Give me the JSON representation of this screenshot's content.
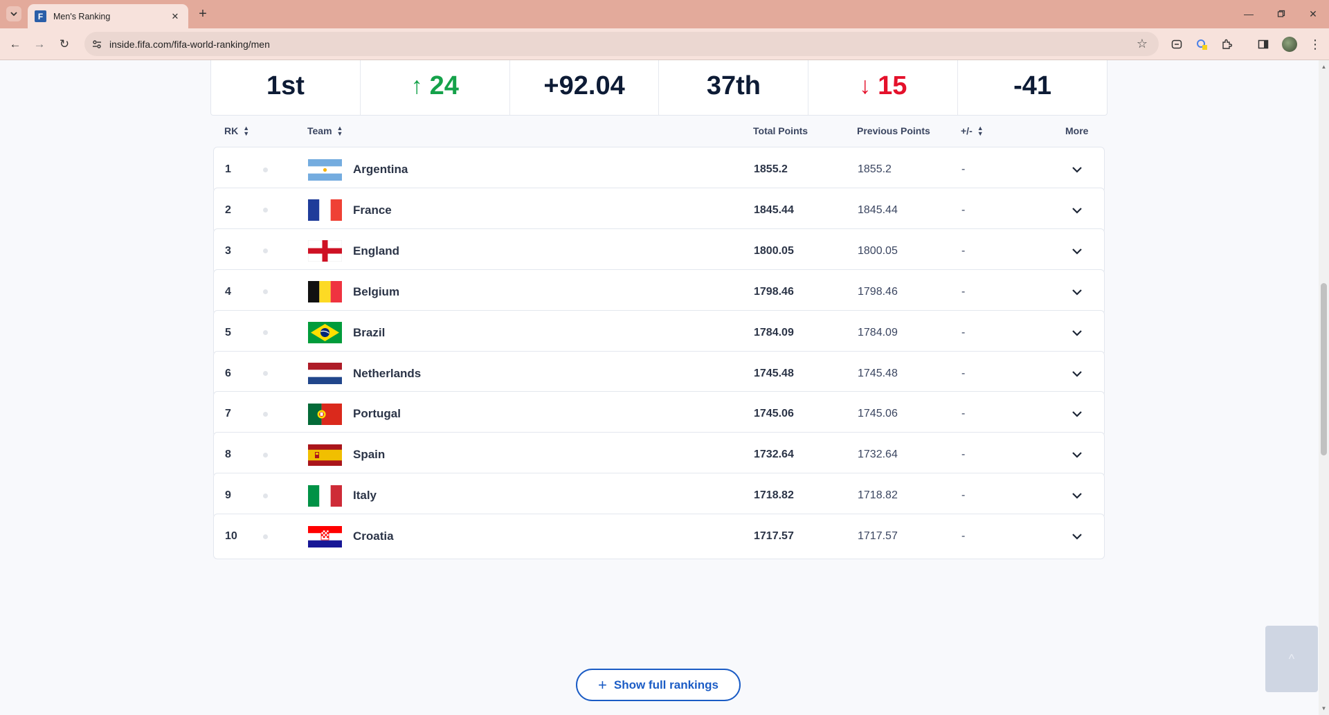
{
  "browser": {
    "tab_title": "Men's Ranking",
    "favicon_letter": "F",
    "url": "inside.fifa.com/fifa-world-ranking/men"
  },
  "stats": [
    {
      "value": "1st",
      "trend": "none"
    },
    {
      "value": "24",
      "trend": "up",
      "color": "#15a24a"
    },
    {
      "value": "+92.04",
      "trend": "none"
    },
    {
      "value": "37th",
      "trend": "none"
    },
    {
      "value": "15",
      "trend": "down",
      "color": "#e4112b"
    },
    {
      "value": "-41",
      "trend": "none"
    }
  ],
  "table": {
    "headers": {
      "rank": "RK",
      "team": "Team",
      "total": "Total Points",
      "previous": "Previous Points",
      "diff": "+/-",
      "more": "More"
    },
    "rows": [
      {
        "rank": "1",
        "team": "Argentina",
        "total": "1855.2",
        "previous": "1855.2",
        "diff": "-",
        "flag": "argentina"
      },
      {
        "rank": "2",
        "team": "France",
        "total": "1845.44",
        "previous": "1845.44",
        "diff": "-",
        "flag": "france"
      },
      {
        "rank": "3",
        "team": "England",
        "total": "1800.05",
        "previous": "1800.05",
        "diff": "-",
        "flag": "england"
      },
      {
        "rank": "4",
        "team": "Belgium",
        "total": "1798.46",
        "previous": "1798.46",
        "diff": "-",
        "flag": "belgium"
      },
      {
        "rank": "5",
        "team": "Brazil",
        "total": "1784.09",
        "previous": "1784.09",
        "diff": "-",
        "flag": "brazil"
      },
      {
        "rank": "6",
        "team": "Netherlands",
        "total": "1745.48",
        "previous": "1745.48",
        "diff": "-",
        "flag": "netherlands"
      },
      {
        "rank": "7",
        "team": "Portugal",
        "total": "1745.06",
        "previous": "1745.06",
        "diff": "-",
        "flag": "portugal"
      },
      {
        "rank": "8",
        "team": "Spain",
        "total": "1732.64",
        "previous": "1732.64",
        "diff": "-",
        "flag": "spain"
      },
      {
        "rank": "9",
        "team": "Italy",
        "total": "1718.82",
        "previous": "1718.82",
        "diff": "-",
        "flag": "italy"
      },
      {
        "rank": "10",
        "team": "Croatia",
        "total": "1717.57",
        "previous": "1717.57",
        "diff": "-",
        "flag": "croatia"
      }
    ]
  },
  "show_full_label": "Show full rankings",
  "back_to_top_icon": "chevron-up-icon"
}
